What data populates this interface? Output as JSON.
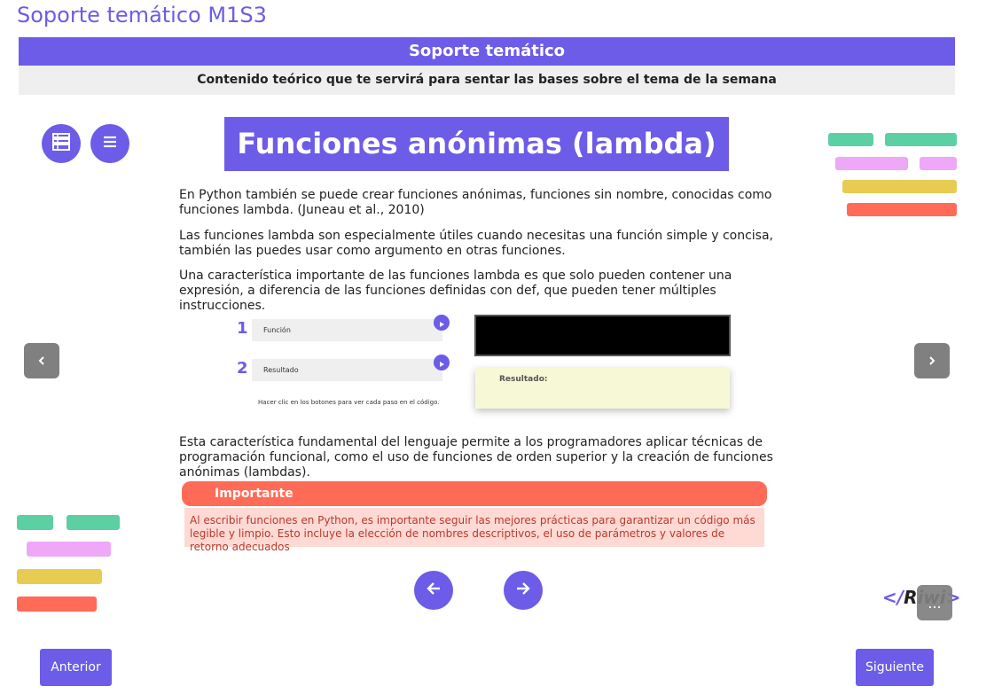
{
  "page": {
    "title": "Soporte temático M1S3"
  },
  "banner": {
    "title": "Soporte temático",
    "subtitle": "Contenido teórico que te servirá para sentar las bases sobre el tema de la semana"
  },
  "topic": {
    "title": "Funciones anónimas (lambda)"
  },
  "paragraphs": [
    "En Python también se puede crear funciones anónimas, funciones sin nombre, conocidas como funciones lambda. (Juneau et al., 2010)",
    "Las funciones lambda son especialmente útiles cuando necesitas una función simple y concisa, también las puedes usar como argumento en otras funciones.",
    "Una característica importante de las funciones lambda es que solo pueden contener una expresión, a diferencia de las funciones definidas con def, que pueden tener múltiples instrucciones.",
    "Esta característica fundamental del lenguaje permite a los programadores aplicar técnicas de programación funcional, como el uso de funciones de orden superior y la creación de funciones anónimas (lambdas)."
  ],
  "steps": [
    {
      "number": "1",
      "label": "Función"
    },
    {
      "number": "2",
      "label": "Resultado"
    }
  ],
  "steps_hint": "Hacer clic en los botones para ver cada paso en el código.",
  "result": {
    "label": "Resultado:"
  },
  "important": {
    "title": "Importante",
    "text": "Al escribir funciones en Python, es importante seguir las mejores prácticas para garantizar un código más legible y limpio. Esto incluye la elección de nombres descriptivos, el uso de parámetros y valores de retorno adecuados"
  },
  "icons": {
    "book": "book-icon",
    "menu": "menu-icon",
    "prev": "chevron-left-icon",
    "next": "chevron-right-icon",
    "arrow_left": "arrow-left-icon",
    "arrow_right": "arrow-right-icon",
    "play": "play-icon",
    "more": "more-icon"
  },
  "logo": {
    "text": "Riwi",
    "prefix": "</",
    "suffix": ">"
  },
  "more": {
    "label": "..."
  },
  "footer": {
    "prev_label": "Anterior",
    "next_label": "Siguiente"
  },
  "colors": {
    "accent": "#6c5ce7",
    "important": "#ff6b57",
    "important_bg": "#ffd9d4",
    "result_bg": "#f7f9d6",
    "deco_green": "#5ccfa3",
    "deco_pink": "#eea8f7",
    "deco_yellow": "#e8cc52",
    "deco_red": "#ff6b57"
  }
}
